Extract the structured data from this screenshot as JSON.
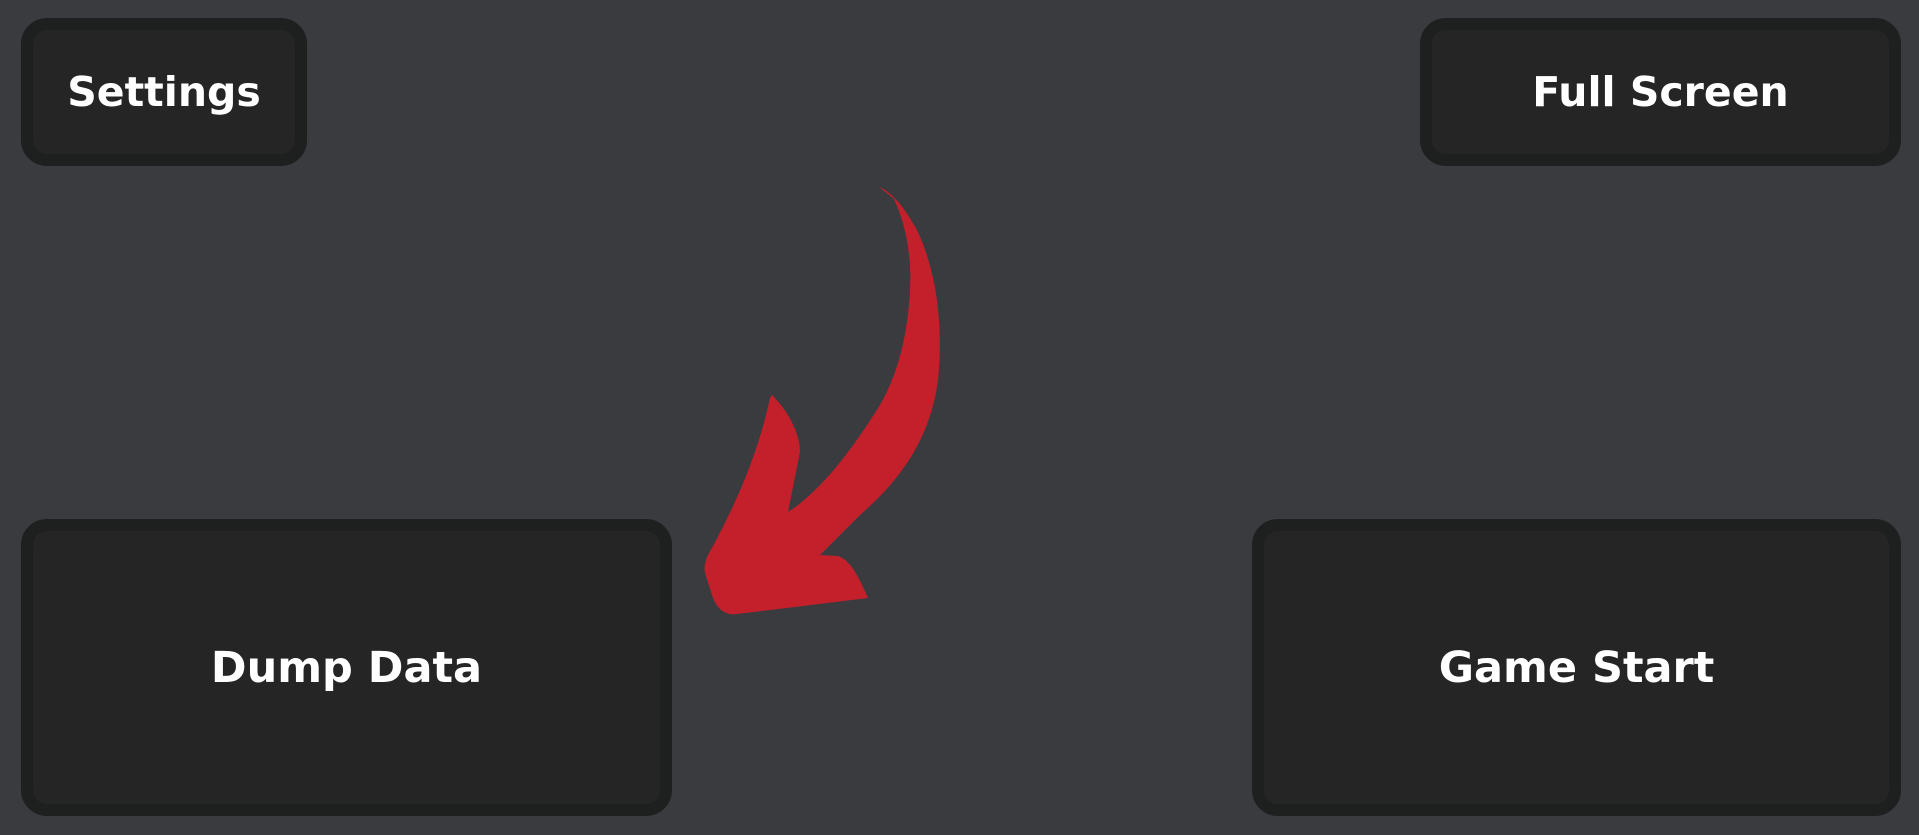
{
  "buttons": {
    "settings": "Settings",
    "full_screen": "Full Screen",
    "dump_data": "Dump Data",
    "game_start": "Game Start"
  },
  "annotation": {
    "icon": "curved-arrow-icon",
    "color": "#c4202b"
  },
  "colors": {
    "background": "#3a3b3f",
    "button_fill": "#252525",
    "button_border": "#1e1f1f",
    "text": "#ffffff"
  }
}
